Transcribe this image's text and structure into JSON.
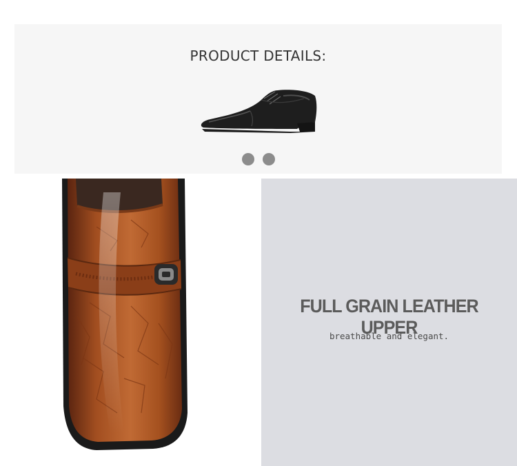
{
  "header": {
    "title": "PRODUCT DETAILS:",
    "carousel_dots": [
      "slide-1",
      "slide-2"
    ],
    "image": "black-oxford-shoe-side-view"
  },
  "feature": {
    "image": "brown-leather-loafer-toe-closeup",
    "title": "FULL GRAIN LEATHER UPPER",
    "subtitle": "breathable and elegant."
  },
  "colors": {
    "header_bg": "#f6f6f6",
    "panel_bg": "#dcdde2",
    "dot": "#8c8c8c",
    "leather": "#a04e22"
  }
}
